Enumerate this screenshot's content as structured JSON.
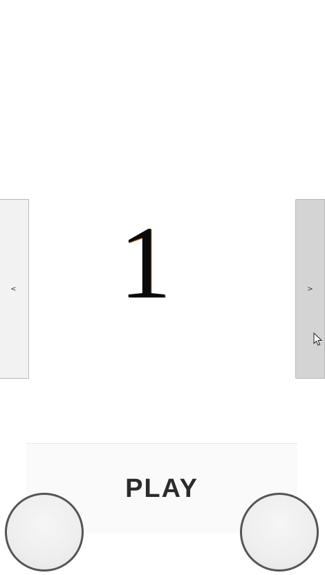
{
  "level": {
    "number": "1"
  },
  "navigation": {
    "prev_label": "<",
    "next_label": ">"
  },
  "play": {
    "label": "PLAY"
  },
  "controls": {
    "left_button_icon": "circle-button",
    "right_button_icon": "circle-button"
  },
  "colors": {
    "background": "#ffffff",
    "prev_button": "#f2f2f2",
    "next_button": "#d4d4d4",
    "play_text": "#2b2b2b",
    "round_button_border": "#555555"
  }
}
